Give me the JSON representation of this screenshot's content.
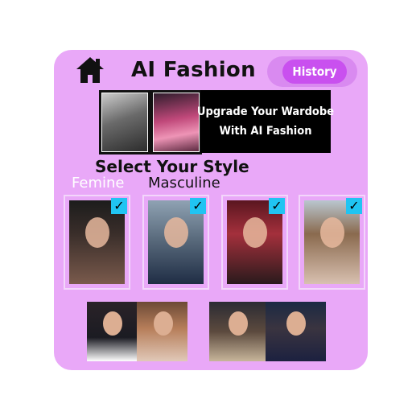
{
  "header": {
    "title": "AI Fashion",
    "history_label": "History",
    "home_icon": "home-icon"
  },
  "banner": {
    "line1": "Upgrade Your Wardobe",
    "line2": "With AI Fashion"
  },
  "style_section": {
    "title": "Select Your Style",
    "tabs": [
      {
        "label": "Femine",
        "active": true
      },
      {
        "label": "Masculine",
        "active": false
      }
    ],
    "cards_checked": [
      true,
      true,
      true,
      true
    ]
  },
  "colors": {
    "card_background": "#e9a8f8",
    "history_button": "#c950ef",
    "checkmark": "#20c4f2",
    "banner_background": "#000000"
  }
}
